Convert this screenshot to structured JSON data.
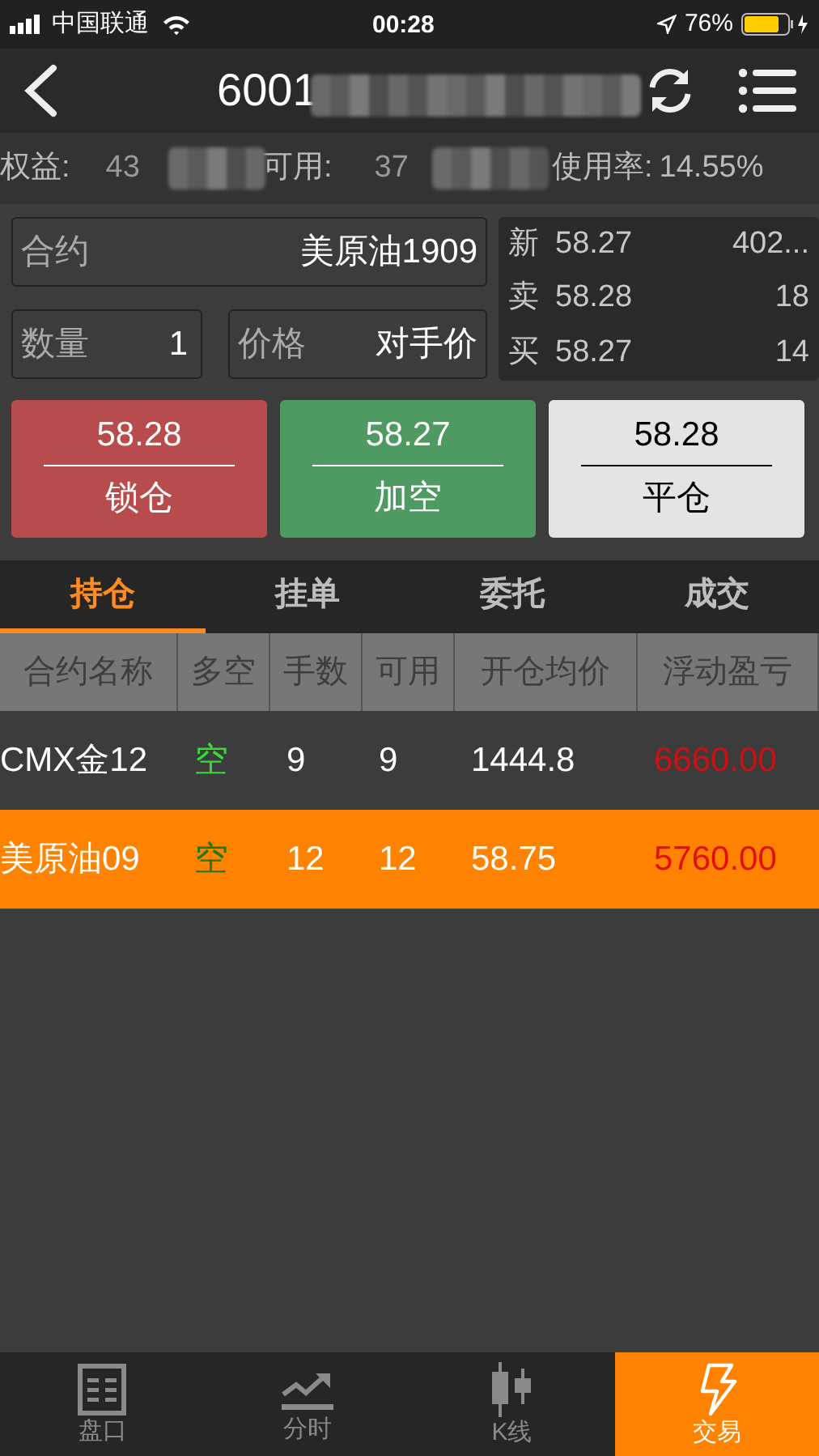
{
  "status_bar": {
    "carrier": "中国联通",
    "time": "00:28",
    "battery": "76%"
  },
  "nav": {
    "title": "6001"
  },
  "account": [
    {
      "label": "权益:",
      "value": "43"
    },
    {
      "label": "可用:",
      "value": "37"
    },
    {
      "label": "使用率:",
      "value": "14.55%"
    }
  ],
  "order_form": {
    "contract": {
      "label": "合约",
      "value": "美原油1909"
    },
    "quantity": {
      "label": "数量",
      "value": "1"
    },
    "price": {
      "label": "价格",
      "value": "对手价"
    }
  },
  "quote": [
    {
      "label": "新",
      "price": "58.27",
      "volume": "402..."
    },
    {
      "label": "卖",
      "price": "58.28",
      "volume": "18"
    },
    {
      "label": "买",
      "price": "58.27",
      "volume": "14"
    }
  ],
  "action_buttons": [
    {
      "kind": "red",
      "price": "58.28",
      "label": "锁仓"
    },
    {
      "kind": "green",
      "price": "58.27",
      "label": "加空"
    },
    {
      "kind": "light",
      "price": "58.28",
      "label": "平仓"
    }
  ],
  "tabs": [
    {
      "label": "持仓",
      "selected": true
    },
    {
      "label": "挂单",
      "selected": false
    },
    {
      "label": "委托",
      "selected": false
    },
    {
      "label": "成交",
      "selected": false
    }
  ],
  "table": {
    "columns": [
      "合约名称",
      "多空",
      "手数",
      "可用",
      "开仓均价",
      "浮动盈亏"
    ],
    "rows": [
      {
        "cells": [
          "CMX金12",
          "空",
          "9",
          "9",
          "1444.8",
          "6660.00"
        ],
        "selected": false
      },
      {
        "cells": [
          "美原油09",
          "空",
          "12",
          "12",
          "58.75",
          "5760.00"
        ],
        "selected": true
      }
    ]
  },
  "bottom_nav": [
    {
      "kind": "board",
      "label": "盘口",
      "selected": false
    },
    {
      "kind": "timeshare",
      "label": "分时",
      "selected": false
    },
    {
      "kind": "kline",
      "label": "K线",
      "selected": false
    },
    {
      "kind": "trade",
      "label": "交易",
      "selected": true
    }
  ]
}
